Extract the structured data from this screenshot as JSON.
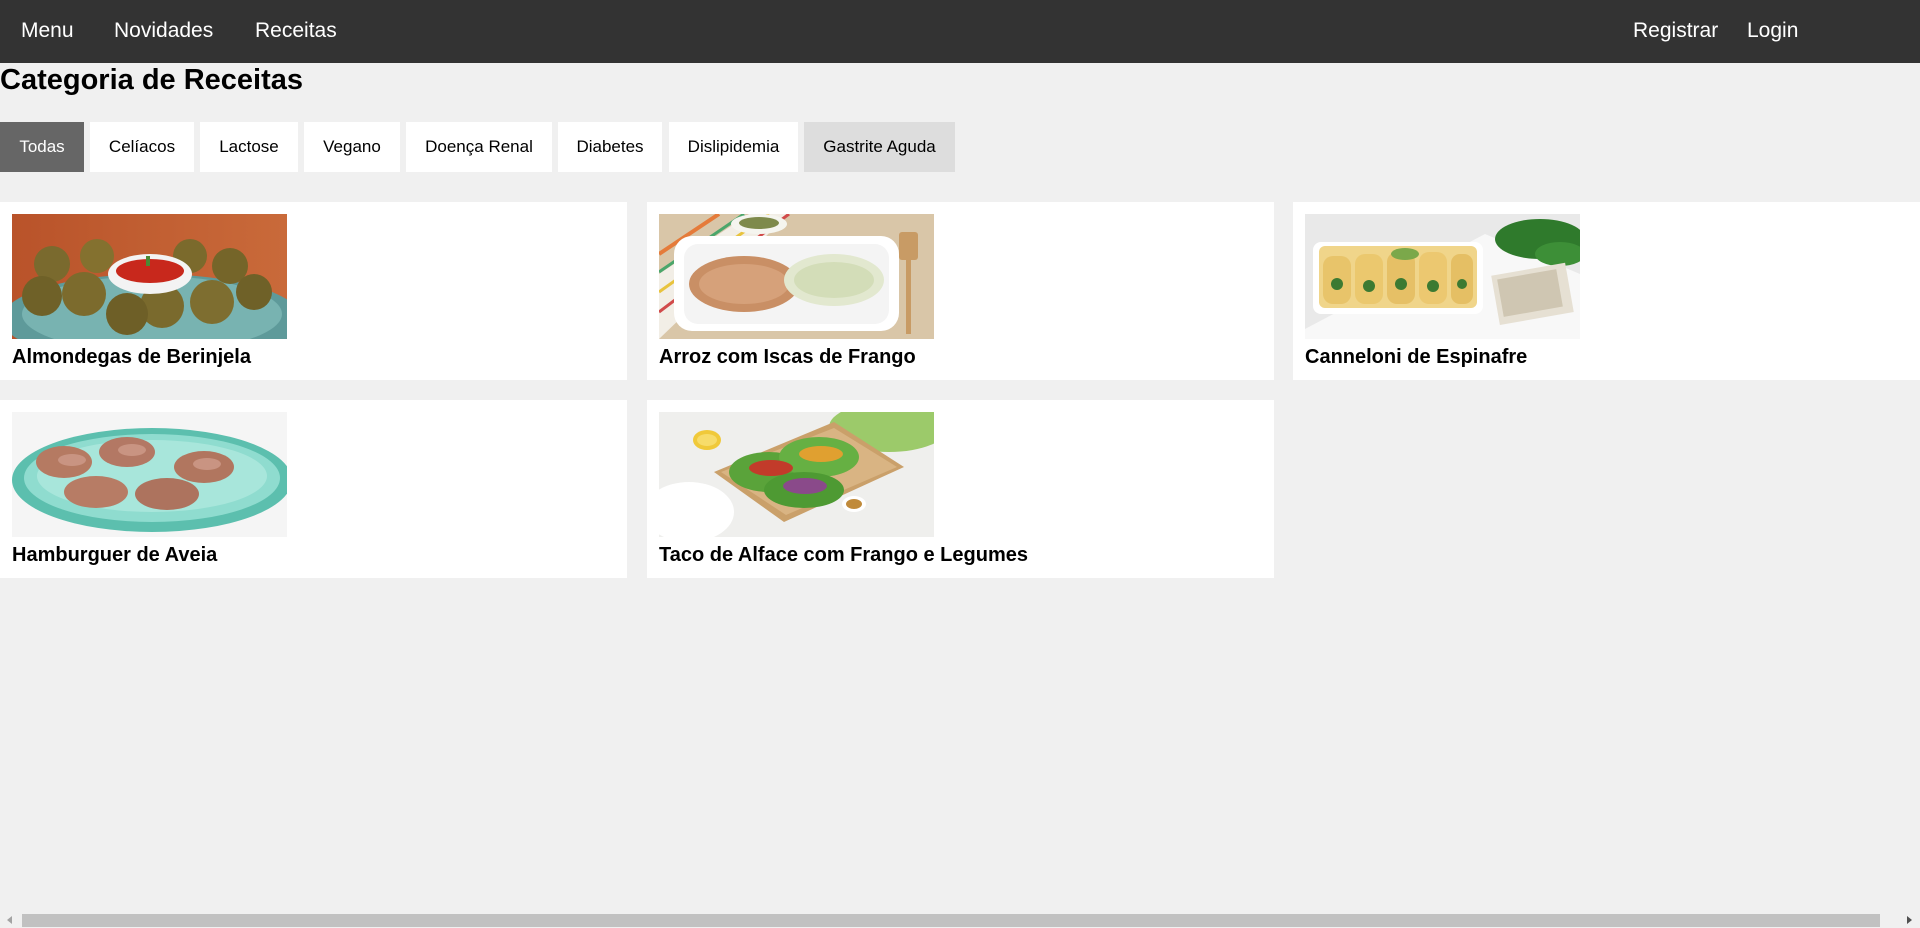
{
  "nav": {
    "left_items": [
      "Menu",
      "Novidades",
      "Receitas"
    ],
    "right_items": [
      "Registrar",
      "Login"
    ]
  },
  "page_title": "Categoria de Receitas",
  "categories": {
    "items": [
      "Todas",
      "Celíacos",
      "Lactose",
      "Vegano",
      "Doença Renal",
      "Diabetes",
      "Dislipidemia",
      "Gastrite Aguda"
    ],
    "active": "Todas",
    "hovered": "Gastrite Aguda"
  },
  "recipes": [
    {
      "title": "Almondegas de Berinjela",
      "image": "eggplant-meatballs-photo"
    },
    {
      "title": "Arroz com Iscas de Frango",
      "image": "rice-chicken-strips-photo"
    },
    {
      "title": "Canneloni de Espinafre",
      "image": "spinach-cannelloni-photo"
    },
    {
      "title": "Hamburguer de Aveia",
      "image": "oat-burgers-photo"
    },
    {
      "title": "Taco de Alface com Frango e Legumes",
      "image": "lettuce-tacos-photo"
    }
  ],
  "colors": {
    "navbar": "#333333",
    "page_background": "#f0f0f0",
    "active_tab": "#666666",
    "hover_tab": "#dddddd"
  }
}
